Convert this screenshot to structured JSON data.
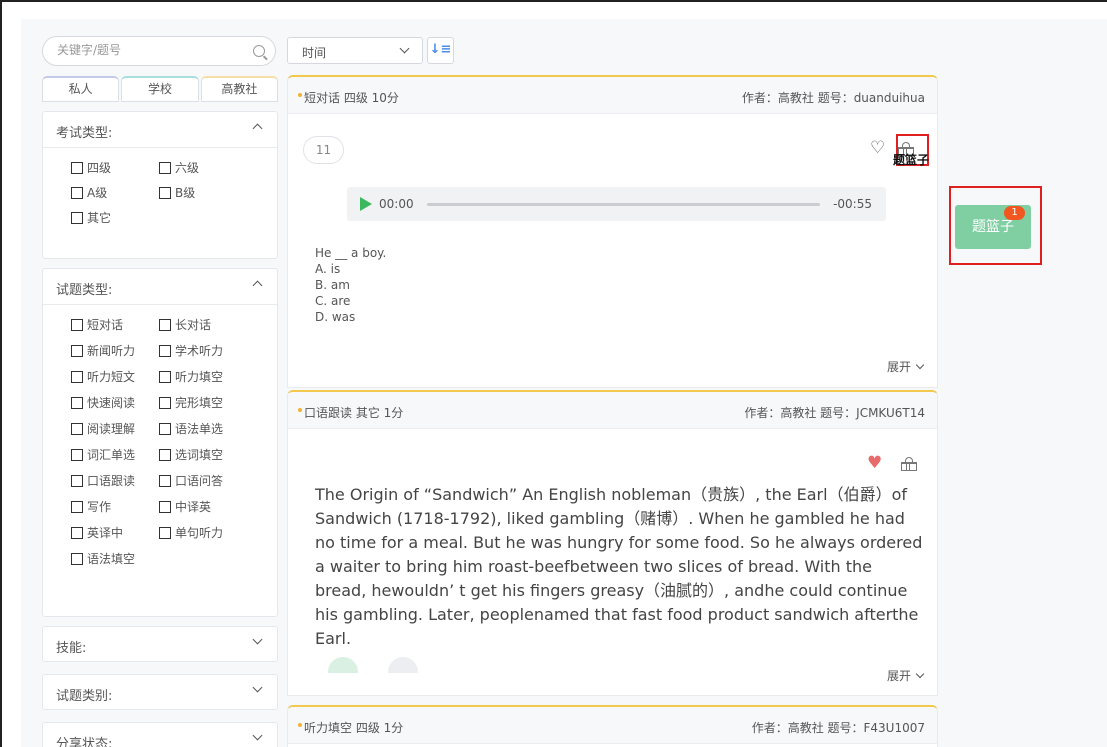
{
  "search": {
    "placeholder": "关键字/题号"
  },
  "source_tabs": [
    "私人",
    "学校",
    "高教社"
  ],
  "filters": {
    "exam_type": {
      "title": "考试类型:",
      "options": [
        "四级",
        "六级",
        "A级",
        "B级",
        "其它"
      ]
    },
    "question_type": {
      "title": "试题类型:",
      "options": [
        "短对话",
        "长对话",
        "新闻听力",
        "学术听力",
        "听力短文",
        "听力填空",
        "快速阅读",
        "完形填空",
        "阅读理解",
        "语法单选",
        "词汇单选",
        "选词填空",
        "口语跟读",
        "口语问答",
        "写作",
        "中译英",
        "英译中",
        "单句听力",
        "语法填空"
      ]
    },
    "skill": {
      "title": "技能:"
    },
    "category": {
      "title": "试题类别:"
    },
    "share_status": {
      "title": "分享状态:"
    }
  },
  "sort": {
    "selected": "时间",
    "order_icon": "sort-ascending-icon"
  },
  "questions": [
    {
      "meta": "短对话  四级  10分",
      "author": "作者：高教社   题号：duanduihua",
      "number": "11",
      "audio": {
        "current": "00:00",
        "remaining": "-00:55"
      },
      "text": "He __ a boy.\nA. is\nB. am\nC. are\nD. was",
      "expand": "展开",
      "basket_tooltip": "题篮子"
    },
    {
      "meta": "口语跟读  其它  1分",
      "author": "作者：高教社   题号：JCMKU6T14",
      "passage": "The Origin of  “Sandwich” An English nobleman（贵族）, the Earl（伯爵）of Sandwich (1718-1792), liked gambling（赌博）. When he gambled he had no time for a meal. But he was hungry for some food. So he always ordered a waiter to bring him roast-beefbetween two slices of bread. With the bread, hewouldn’ t get his fingers greasy（油腻的）, andhe could continue his gambling. Later, peoplenamed that fast food product sandwich afterthe Earl.",
      "expand": "展开"
    },
    {
      "meta": "听力填空  四级  1分",
      "author": "作者：高教社   题号：F43U1007"
    }
  ],
  "floating_basket": {
    "label": "题篮子",
    "count": "1"
  },
  "colors": {
    "accent": "#4a8de8",
    "play": "#3bb85e",
    "basket": "#7fcfa3",
    "badge": "#f2571f",
    "highlight": "#e02020",
    "card_top": "#f2c94c"
  }
}
